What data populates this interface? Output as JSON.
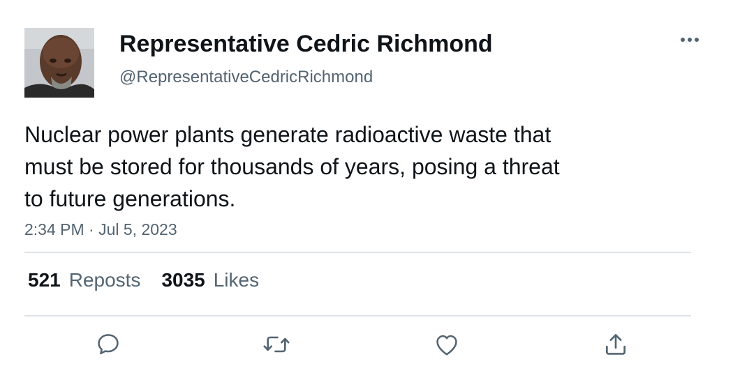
{
  "author": {
    "display_name": "Representative Cedric Richmond",
    "handle": "@RepresentativeCedricRichmond",
    "avatar_icon": "profile-photo"
  },
  "tweet": {
    "text_lines": [
      "Nuclear power plants generate radioactive waste that",
      "must be stored for thousands of years, posing a threat",
      "to future generations."
    ],
    "timestamp": "2:34 PM · Jul 5, 2023"
  },
  "stats": {
    "reposts_count": "521",
    "reposts_label": "Reposts",
    "likes_count": "3035",
    "likes_label": "Likes"
  },
  "actions": {
    "reply_icon": "speech-bubble-icon",
    "retweet_icon": "retweet-arrows-icon",
    "like_icon": "heart-icon",
    "share_icon": "share-upload-icon",
    "more_icon": "ellipsis-icon"
  },
  "colors": {
    "text_primary": "#0f1419",
    "text_secondary": "#536471",
    "divider": "#dfe3e6"
  }
}
